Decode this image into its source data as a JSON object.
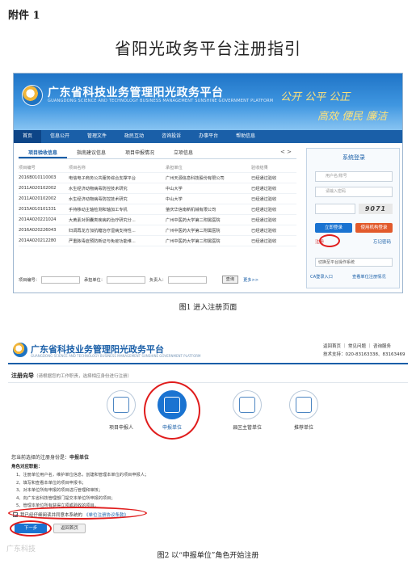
{
  "annex_label": "附件 1",
  "doc_title": "省阳光政务平台注册指引",
  "figure1": {
    "site_name": "广东省科技业务管理阳光政务平台",
    "site_name_en": "GUANGDONG SCIENCE AND TECHNOLOGY BUSINESS MANAGEMENT SUNSHINE GOVERNMENT PLATFORM",
    "slogan_line1": "公开 公平 公正",
    "slogan_line2": "高效 便民 廉洁",
    "nav": [
      "首页",
      "信息公开",
      "管理文件",
      "政民互动",
      "咨询投诉",
      "办事平台",
      "帮助信息"
    ],
    "tabs": [
      "项目验收信息",
      "指南建议信息",
      "项目申报情况",
      "立项信息"
    ],
    "tab_arrows": "< >",
    "table_headers": [
      "项目编号",
      "项目名称",
      "承担单位",
      "验收结果"
    ],
    "table_rows": [
      [
        "2016B010110003",
        "电信电子商务公共服务综合支撑平台",
        "广州天源信息科技股份有限公司",
        "已经通过验收"
      ],
      [
        "2011A020102002",
        "水生经济动物病毒防控技术研究",
        "中山大学",
        "已经通过验收"
      ],
      [
        "2011A020102002",
        "水生经济动物病毒防控技术研究",
        "中山大学",
        "已经通过验收"
      ],
      [
        "2015A010101331",
        "手持移动主轴检测和轴加工专机",
        "肇庆华信南新机械有限公司",
        "已经通过验收"
      ],
      [
        "2014A020221024",
        "大黄素对阴囊类疾病的治疗研究分...",
        "广州中医药大学第二附属医院",
        "已经通过验收"
      ],
      [
        "2016A020226043",
        "妇调再龙方加抗糖治疗湿病支持性...",
        "广州中医药大学第二附属医院",
        "已经通过验收"
      ],
      [
        "2014A020212280",
        "严重脓毒症预防新证与免疫功能维...",
        "广州中医药大学第二附属医院",
        "已经通过验收"
      ]
    ],
    "filter": {
      "project_no_label": "项目编号：",
      "unit_label": "承担单位：",
      "leader_label": "负责人：",
      "query_button": "查询",
      "more_link": "更多>>"
    },
    "login": {
      "title": "系统登录",
      "username_placeholder": "用户名/账号",
      "password_placeholder": "请输入密码",
      "captcha_text": "9071",
      "login_button": "立即登录",
      "agent_login_button": "使用机构登录",
      "register_link": "注册",
      "forgot_link": "忘记密码",
      "switch_select": "切换至平台操作系统",
      "ca_link": "CA登录入口",
      "ca_help_link": "查看单位注册情况"
    },
    "caption": "图1  进入注册页面"
  },
  "figure2": {
    "site_name": "广东省科技业务管理阳光政务平台",
    "site_name_en": "GUANGDONG SCIENCE AND TECHNOLOGY BUSINESS MANAGEMENT SUNSHINE GOVERNMENT PLATFORM",
    "top_links": "返回首页 ｜ 常见问题 ｜ 咨询服务",
    "phone": "技术支持：020-83163338、83163469",
    "wizard_title": "注册向导",
    "wizard_hint": "（请根据您的工作职责，选择相应身份进行注册）",
    "roles": [
      "项目申报人",
      "申报单位",
      "县区主管单位",
      "推荐单位"
    ],
    "selected_text": "您当前选择的注册身份是：",
    "selected_value": "申报单位",
    "duty_title": "角色对应职能：",
    "duties": [
      "1、注册单位用户名，维护单位信息，创建和管理本单位的项目申报人；",
      "2、填写和查看本单位的项目申报书；",
      "3、对本单位所有申报的项目进行管理和审核；",
      "4、向广东省科技管理部门提交本单位所申报的项目；",
      "5、管理本单位所有获得立项或验收的项目。"
    ],
    "agree_text": "我已经仔细阅读并同意本系统的",
    "agree_link": "《单位注册协议条款》",
    "next_button": "下一步",
    "back_button": "返回首页"
  },
  "watermark": "广东科技",
  "caption2": "图2  以“申报单位”角色开始注册"
}
